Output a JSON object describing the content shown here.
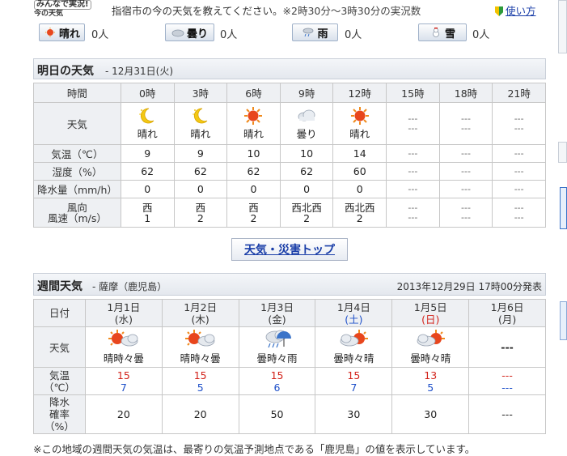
{
  "top": {
    "logo_line1": "みんなで実況!",
    "logo_line2": "今の天気",
    "intro_text": "指宿市の今の天気を教えてください。",
    "intro_note": "※2時30分～3時30分の実況数",
    "howto_link": "使い方"
  },
  "report_buttons": [
    {
      "label": "晴れ",
      "count": "0人",
      "icon": "sunny-icon"
    },
    {
      "label": "曇り",
      "count": "0人",
      "icon": "cloudy-icon"
    },
    {
      "label": "雨",
      "count": "0人",
      "icon": "rain-icon"
    },
    {
      "label": "雪",
      "count": "0人",
      "icon": "snow-icon"
    }
  ],
  "tomorrow": {
    "title": "明日の天気",
    "date": "- 12月31日(火)",
    "row_labels": {
      "time": "時間",
      "weather": "天気",
      "temp": "気温（℃）",
      "humidity": "湿度（%）",
      "precip": "降水量（mm/h）",
      "wind_dir": "風向",
      "wind_speed": "風速（m/s）"
    },
    "columns": [
      {
        "time": "0時",
        "icon": "moon-icon",
        "weather": "晴れ",
        "temp": "9",
        "humidity": "62",
        "precip": "0",
        "wind_dir": "西",
        "wind_speed": "1"
      },
      {
        "time": "3時",
        "icon": "moon-icon",
        "weather": "晴れ",
        "temp": "9",
        "humidity": "62",
        "precip": "0",
        "wind_dir": "西",
        "wind_speed": "2"
      },
      {
        "time": "6時",
        "icon": "sun-icon",
        "weather": "晴れ",
        "temp": "10",
        "humidity": "62",
        "precip": "0",
        "wind_dir": "西",
        "wind_speed": "2"
      },
      {
        "time": "9時",
        "icon": "cloud-icon",
        "weather": "曇り",
        "temp": "10",
        "humidity": "62",
        "precip": "0",
        "wind_dir": "西北西",
        "wind_speed": "2"
      },
      {
        "time": "12時",
        "icon": "sun-icon",
        "weather": "晴れ",
        "temp": "14",
        "humidity": "60",
        "precip": "0",
        "wind_dir": "西北西",
        "wind_speed": "2"
      },
      {
        "time": "15時",
        "icon": "",
        "weather": "---",
        "temp": "---",
        "humidity": "---",
        "precip": "---",
        "wind_dir": "---",
        "wind_speed": "---"
      },
      {
        "time": "18時",
        "icon": "",
        "weather": "---",
        "temp": "---",
        "humidity": "---",
        "precip": "---",
        "wind_dir": "---",
        "wind_speed": "---"
      },
      {
        "time": "21時",
        "icon": "",
        "weather": "---",
        "temp": "---",
        "humidity": "---",
        "precip": "---",
        "wind_dir": "---",
        "wind_speed": "---"
      }
    ],
    "placeholder": "---"
  },
  "top_link": "天気・災害トップ",
  "weekly": {
    "title": "週間天気",
    "region": "- 薩摩（鹿児島）",
    "issued": "2013年12月29日 17時00分発表",
    "row_labels": {
      "date": "日付",
      "weather": "天気",
      "temp_1": "気温",
      "temp_2": "（℃）",
      "precip_1": "降水",
      "precip_2": "確率",
      "precip_3": "（%）"
    },
    "days": [
      {
        "date": "1月1日",
        "dow": "(水)",
        "dow_color": "normal",
        "icon": "sun-cloud-icon",
        "weather": "晴時々曇",
        "high": "15",
        "low": "7",
        "precip": "20"
      },
      {
        "date": "1月2日",
        "dow": "(木)",
        "dow_color": "normal",
        "icon": "sun-cloud-icon",
        "weather": "晴時々曇",
        "high": "15",
        "low": "5",
        "precip": "20"
      },
      {
        "date": "1月3日",
        "dow": "(金)",
        "dow_color": "normal",
        "icon": "cloud-rain-icon",
        "weather": "曇時々雨",
        "high": "15",
        "low": "6",
        "precip": "50"
      },
      {
        "date": "1月4日",
        "dow": "(土)",
        "dow_color": "sat",
        "icon": "cloud-sun-icon",
        "weather": "曇時々晴",
        "high": "15",
        "low": "7",
        "precip": "30"
      },
      {
        "date": "1月5日",
        "dow": "(日)",
        "dow_color": "sun",
        "icon": "cloud-sun-icon",
        "weather": "曇時々晴",
        "high": "13",
        "low": "5",
        "precip": "30"
      },
      {
        "date": "1月6日",
        "dow": "(月)",
        "dow_color": "normal",
        "icon": "",
        "weather": "---",
        "high": "---",
        "low": "---",
        "precip": "---"
      }
    ]
  },
  "footnote": "※この地域の週間天気の気温は、最寄りの気温予測地点である「鹿児島」の値を表示しています。",
  "colors": {
    "high_temp": "#d3241c",
    "low_temp": "#1d4fc9",
    "link": "#1a3ea8"
  }
}
